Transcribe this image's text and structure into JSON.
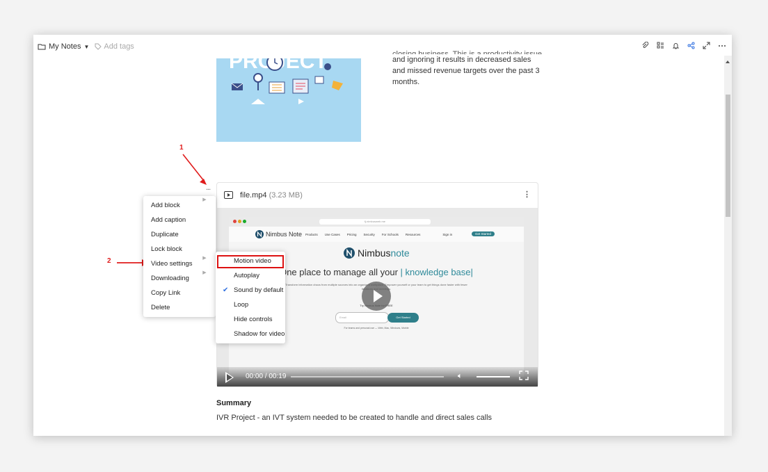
{
  "topbar": {
    "notebook": "My Notes",
    "add_tags": "Add tags"
  },
  "content": {
    "project_image_text": "PROJECT",
    "intro_cutoff": "closing business. This is a productivity issue",
    "intro_lines": "and ignoring it results in decreased sales and missed revenue targets over the past 3 months."
  },
  "annotations": {
    "one": "1",
    "two": "2"
  },
  "block_handle": "...",
  "context_menu": {
    "items": [
      {
        "label": "Add block",
        "submenu": true
      },
      {
        "label": "Add caption",
        "submenu": false
      },
      {
        "label": "Duplicate",
        "submenu": false
      },
      {
        "label": "Lock block",
        "submenu": false
      },
      {
        "label": "Video settings",
        "submenu": true
      },
      {
        "label": "Downloading",
        "submenu": true
      },
      {
        "label": "Copy Link",
        "submenu": false
      },
      {
        "label": "Delete",
        "submenu": false
      }
    ]
  },
  "video_settings_menu": {
    "items": [
      {
        "label": "Motion video",
        "checked": false,
        "highlighted": true
      },
      {
        "label": "Autoplay",
        "checked": false
      },
      {
        "label": "Sound by default",
        "checked": true
      },
      {
        "label": "Loop",
        "checked": false
      },
      {
        "label": "Hide controls",
        "checked": false
      },
      {
        "label": "Shadow for video",
        "checked": false
      }
    ]
  },
  "video": {
    "filename": "file.mp4",
    "filesize": "(3.23 MB)",
    "time": "00:00 / 00:19",
    "preview": {
      "url": "fj.nimbusweb.me",
      "brand_small": "Nimbus Note",
      "nav_links": [
        "Products",
        "Use Cases",
        "Pricing",
        "Security",
        "For Schools",
        "Resources"
      ],
      "sign_in": "Sign in",
      "get_started_nav": "Get Started",
      "brand_big_1": "Nimbus",
      "brand_big_2": "note",
      "headline_1": "One place to manage all your",
      "headline_2": "knowledge base",
      "subtext": "Transform information chaos from multiple sources into an organized workplace. Empower yourself or your team to get things done faster with fewer iterations and meetings.",
      "try_text": "Try Nimbus Note for FREE",
      "email_placeholder": "Email",
      "get_started": "Get Started",
      "for_teams": "For teams and personal use — Web, Mac, Windows, Mobile"
    }
  },
  "summary": {
    "heading": "Summary",
    "text": "IVR Project - an IVT system needed to be created to handle and direct sales calls"
  },
  "colors": {
    "accent": "#2f8a9a",
    "annotation_red": "#e01b1b",
    "check_blue": "#2f6fe0"
  }
}
